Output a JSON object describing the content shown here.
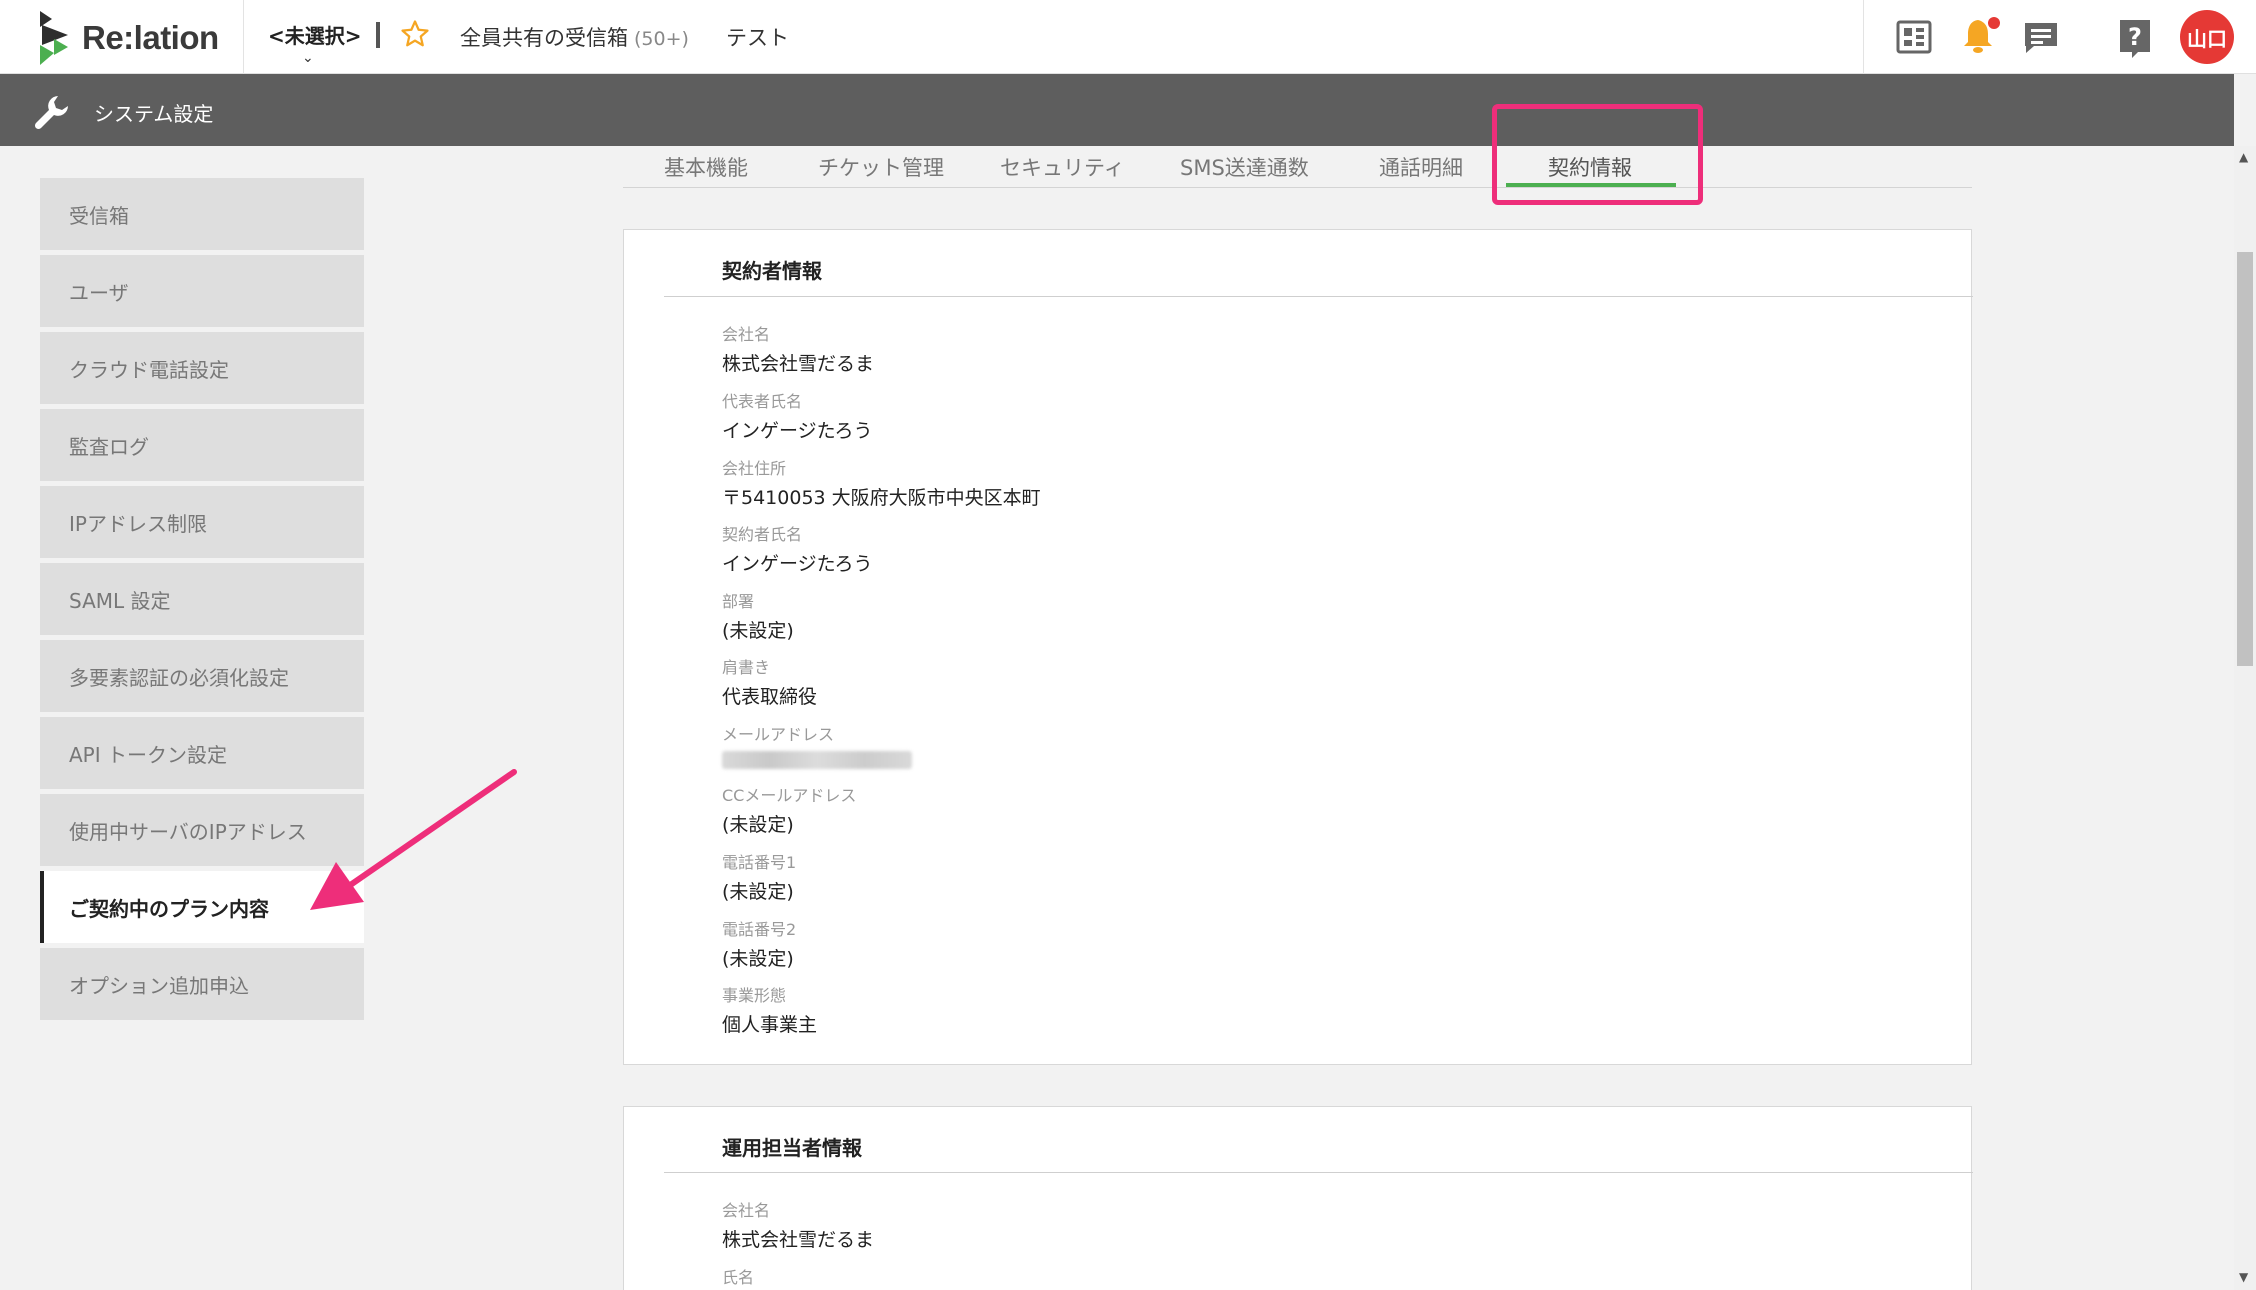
{
  "app": {
    "logo_text": "Re:lation"
  },
  "header": {
    "inbox_select": "<未選択>",
    "shared_inbox": "全員共有の受信箱",
    "shared_count": "(50+)",
    "test_label": "テスト",
    "avatar_text": "山口",
    "colors": {
      "accent": "#4caf50",
      "star": "#f5a623",
      "bell": "#f5a623",
      "avatar": "#e53935"
    }
  },
  "sysbar": {
    "title": "システム設定"
  },
  "sidebar": {
    "items": [
      {
        "label": "受信箱"
      },
      {
        "label": "ユーザ"
      },
      {
        "label": "クラウド電話設定"
      },
      {
        "label": "監査ログ"
      },
      {
        "label": "IPアドレス制限"
      },
      {
        "label": "SAML 設定"
      },
      {
        "label": "多要素認証の必須化設定"
      },
      {
        "label": "API トークン設定"
      },
      {
        "label": "使用中サーバのIPアドレス"
      },
      {
        "label": "ご契約中のプラン内容"
      },
      {
        "label": "オプション追加申込"
      }
    ],
    "active_item": "ご契約中のプラン内容"
  },
  "tabs": [
    {
      "label": "基本機能"
    },
    {
      "label": "チケット管理"
    },
    {
      "label": "セキュリティ"
    },
    {
      "label": "SMS送達通数"
    },
    {
      "label": "通話明細"
    },
    {
      "label": "契約情報"
    }
  ],
  "active_tab": "契約情報",
  "contractor": {
    "title": "契約者情報",
    "fields": [
      {
        "label": "会社名",
        "value": "株式会社雪だるま"
      },
      {
        "label": "代表者氏名",
        "value": "インゲージたろう"
      },
      {
        "label": "会社住所",
        "value": "〒5410053 大阪府大阪市中央区本町"
      },
      {
        "label": "契約者氏名",
        "value": "インゲージたろう"
      },
      {
        "label": "部署",
        "value": "(未設定)"
      },
      {
        "label": "肩書き",
        "value": "代表取締役"
      },
      {
        "label": "メールアドレス",
        "value": ""
      },
      {
        "label": "CCメールアドレス",
        "value": "(未設定)"
      },
      {
        "label": "電話番号1",
        "value": "(未設定)"
      },
      {
        "label": "電話番号2",
        "value": "(未設定)"
      },
      {
        "label": "事業形態",
        "value": "個人事業主"
      }
    ]
  },
  "operator": {
    "title": "運用担当者情報",
    "fields": [
      {
        "label": "会社名",
        "value": "株式会社雪だるま"
      },
      {
        "label": "氏名",
        "value": ""
      }
    ]
  }
}
